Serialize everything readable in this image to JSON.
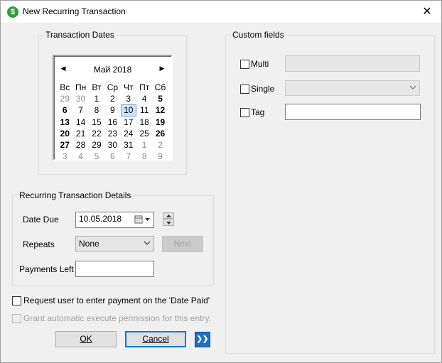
{
  "window": {
    "title": "New Recurring Transaction",
    "icon_glyph": "$",
    "close_glyph": "✕"
  },
  "dates_group": {
    "title": "Transaction Dates"
  },
  "calendar": {
    "month_label": "Май 2018",
    "prev_glyph": "◀",
    "next_glyph": "▶",
    "weekdays": [
      "Вс",
      "Пн",
      "Вт",
      "Ср",
      "Чт",
      "Пт",
      "Сб"
    ],
    "days": [
      {
        "d": "29",
        "other": true
      },
      {
        "d": "30",
        "other": true
      },
      {
        "d": "1"
      },
      {
        "d": "2"
      },
      {
        "d": "3"
      },
      {
        "d": "4"
      },
      {
        "d": "5",
        "bold": true
      },
      {
        "d": "6",
        "bold": true
      },
      {
        "d": "7"
      },
      {
        "d": "8"
      },
      {
        "d": "9"
      },
      {
        "d": "10",
        "today": true
      },
      {
        "d": "11"
      },
      {
        "d": "12",
        "bold": true
      },
      {
        "d": "13",
        "bold": true
      },
      {
        "d": "14"
      },
      {
        "d": "15"
      },
      {
        "d": "16"
      },
      {
        "d": "17"
      },
      {
        "d": "18"
      },
      {
        "d": "19",
        "bold": true
      },
      {
        "d": "20",
        "bold": true
      },
      {
        "d": "21"
      },
      {
        "d": "22"
      },
      {
        "d": "23"
      },
      {
        "d": "24"
      },
      {
        "d": "25"
      },
      {
        "d": "26",
        "bold": true
      },
      {
        "d": "27",
        "bold": true
      },
      {
        "d": "28"
      },
      {
        "d": "29"
      },
      {
        "d": "30"
      },
      {
        "d": "31"
      },
      {
        "d": "1",
        "other": true
      },
      {
        "d": "2",
        "other": true
      },
      {
        "d": "3",
        "other": true
      },
      {
        "d": "4",
        "other": true
      },
      {
        "d": "5",
        "other": true
      },
      {
        "d": "6",
        "other": true
      },
      {
        "d": "7",
        "other": true
      },
      {
        "d": "8",
        "other": true
      },
      {
        "d": "9",
        "other": true
      }
    ]
  },
  "details_group": {
    "title": "Recurring Transaction Details",
    "date_due_label": "Date Due",
    "date_due_value": "10.05.2018",
    "repeats_label": "Repeats",
    "repeats_value": "None",
    "next_label": "Next",
    "payments_left_label": "Payments Left",
    "payments_left_value": ""
  },
  "options": {
    "request_user_label": "Request user to enter payment on the 'Date Paid'",
    "grant_permission_label": "Grant automatic execute permission for this entry."
  },
  "buttons": {
    "ok_label": "OK",
    "cancel_label": "Cancel",
    "expand_glyph": "❯❯"
  },
  "custom_fields": {
    "title": "Custom fields",
    "multi_label": "Multi",
    "multi_value": "",
    "single_label": "Single",
    "single_value": "",
    "tag_label": "Tag",
    "tag_value": ""
  },
  "colors": {
    "accent": "#0078d7",
    "window_bg": "#f0f0f0",
    "app_icon": "#2e9e3f"
  }
}
